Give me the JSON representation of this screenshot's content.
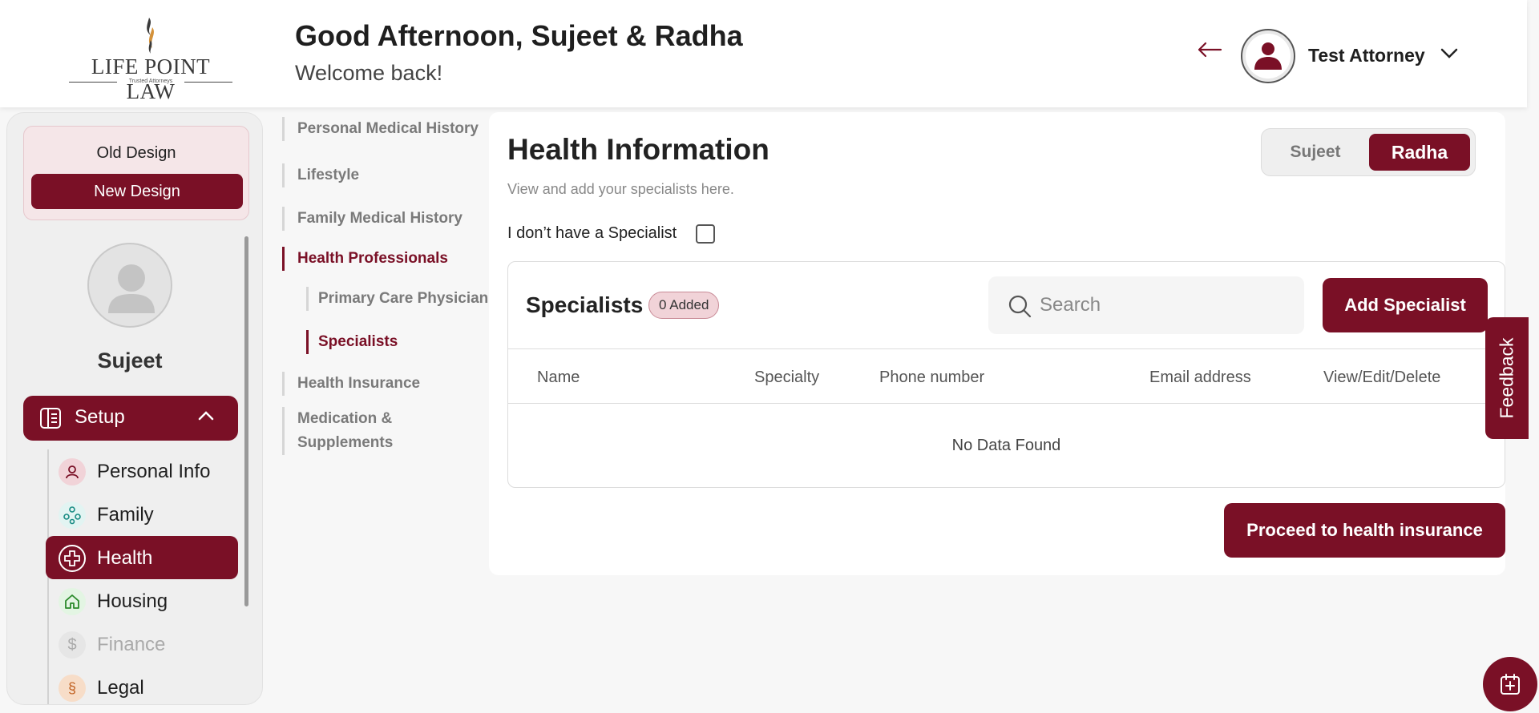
{
  "header": {
    "logo_text": "LIFE POINT LAW",
    "logo_tagline": "Trusted Attorneys",
    "greeting": "Good Afternoon, Sujeet & Radha",
    "welcome": "Welcome back!",
    "user_name": "Test Attorney"
  },
  "sidebar": {
    "old_design": "Old Design",
    "new_design": "New Design",
    "profile_name": "Sujeet",
    "setup_label": "Setup",
    "items": [
      {
        "label": "Personal Info",
        "icon": "person-icon",
        "state": "normal"
      },
      {
        "label": "Family",
        "icon": "family-icon",
        "state": "normal"
      },
      {
        "label": "Health",
        "icon": "medical-cross-icon",
        "state": "active"
      },
      {
        "label": "Housing",
        "icon": "home-icon",
        "state": "normal"
      },
      {
        "label": "Finance",
        "icon": "dollar-icon",
        "state": "disabled"
      },
      {
        "label": "Legal",
        "icon": "legal-icon",
        "state": "normal"
      }
    ]
  },
  "subnav": {
    "items": [
      "Personal Medical History",
      "Lifestyle",
      "Family Medical History",
      "Health Professionals",
      "Primary Care Physician",
      "Specialists",
      "Health Insurance",
      "Medication &",
      "Supplements"
    ]
  },
  "main": {
    "title": "Health Information",
    "subtitle": "View and add your specialists here.",
    "toggle": [
      "Sujeet",
      "Radha"
    ],
    "no_specialist_label": "I don’t have a Specialist",
    "card": {
      "title": "Specialists",
      "badge": "0 Added",
      "search_placeholder": "Search",
      "add_button": "Add Specialist",
      "columns": [
        "Name",
        "Specialty",
        "Phone number",
        "Email address",
        "View/Edit/Delete"
      ],
      "empty": "No Data Found"
    },
    "proceed_button": "Proceed to health insurance"
  },
  "feedback_label": "Feedback",
  "colors": {
    "brand": "#7a1026",
    "brand_light": "#f5e6e8"
  }
}
